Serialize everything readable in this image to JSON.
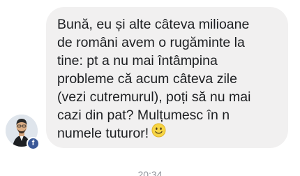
{
  "message": {
    "text": "Bună, eu și alte câteva milioane\nde români avem o rugăminte la\ntine: pt a nu mai întâmpina\nprobleme că acum câteva zile\n(vezi cutremurul), poți să nu mai\ncazi din pat? Mulțumesc în n\nnumele tuturor!",
    "emoji": "smiling-face",
    "bubble_color": "#f1f0f0"
  },
  "sender": {
    "avatar": "person-photo",
    "badge": "f",
    "badge_color": "#3b5998"
  },
  "timestamp": "20:34"
}
